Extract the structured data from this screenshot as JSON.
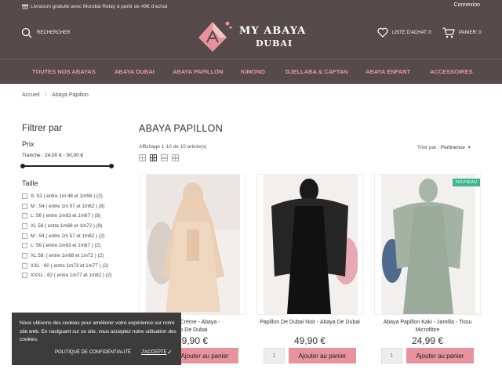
{
  "topbar": {
    "promo": "Livraison gratuite avec Mondial Relay à partir de 49€ d'achat",
    "login": "Connexion"
  },
  "header": {
    "search_label": "RECHERCHER",
    "brand_line1": "MY ABAYA",
    "brand_line2": "DUBAI",
    "wishlist_label": "LISTE D'ACHAT: 0",
    "cart_label": "PANIER: 0"
  },
  "nav": [
    "TOUTES NOS ABAYAS",
    "ABAYA DUBAI",
    "ABAYA PAPILLON",
    "KIMONO",
    "DJELLABA & CAFTAN",
    "ABAYA ENFANT",
    "ACCESSOIRES"
  ],
  "breadcrumb": {
    "home": "Accueil",
    "sep": "/",
    "current": "Abaya Papillon"
  },
  "filters": {
    "title": "Filtrer par",
    "price_title": "Prix",
    "price_range": "Tranche : 24,00 € - 50,00 €",
    "size_title": "Taille",
    "sizes": [
      "S: 52 ( entre 1m 48 et 1m56 ) (2)",
      "M : 54 ( entre 1m 57 et 1m62 ) (8)",
      "L: 56 ( entre 1m63 et 1m67 ) (8)",
      "XL 58 ( entre 1m68 et 1m72 ) (8)",
      "M : 54 ( entre 1m 57 et 1m62 ) (2)",
      "L: 56 ( entre 1m63 et 1m67 ) (2)",
      "XL 58: ( entre 1m68 et 1m72 ) (2)",
      "XXL : 60 ( entre 1m73 et 1m77 ) (2)",
      "XXXL : 62 ( entre 1m77 et 1m82 ) (2)"
    ]
  },
  "listing": {
    "title": "ABAYA PAPILLON",
    "count": "Affichage 1-10 de 10 article(s)",
    "sort_label": "Trier par :",
    "sort_value": "Pertinence"
  },
  "products": [
    {
      "name_line1": "Dubai Crème - Abaya -",
      "name_line2": "no De Dubai",
      "price": "49,90 €",
      "qty": "1",
      "cta": "Ajouter au panier"
    },
    {
      "name_line1": "Papillon De Dubai Noir - Abaya De Dubai",
      "name_line2": "",
      "price": "49,90 €",
      "qty": "1",
      "cta": "Ajouter au panier"
    },
    {
      "name_line1": "Abaya Papillon Kaki - Jamilla - Tissu",
      "name_line2": "Microfibre",
      "price": "24,99 €",
      "qty": "1",
      "cta": "Ajouter au panier",
      "badge": "NOUVEAU"
    }
  ],
  "cookie": {
    "message": "Nous utilisons des cookies pour améliorer votre expérience sur notre site web. En naviguant sur ce site, vous acceptez notre utilisation des cookies.",
    "policy": "POLITIQUE DE CONFIDENTIALITÉ",
    "accept": "J'ACCEPTE"
  },
  "colors": {
    "header_bg": "#564a4a",
    "accent_pink": "#e7939e",
    "nav_text": "#e39aa3",
    "badge": "#3fb58b"
  }
}
